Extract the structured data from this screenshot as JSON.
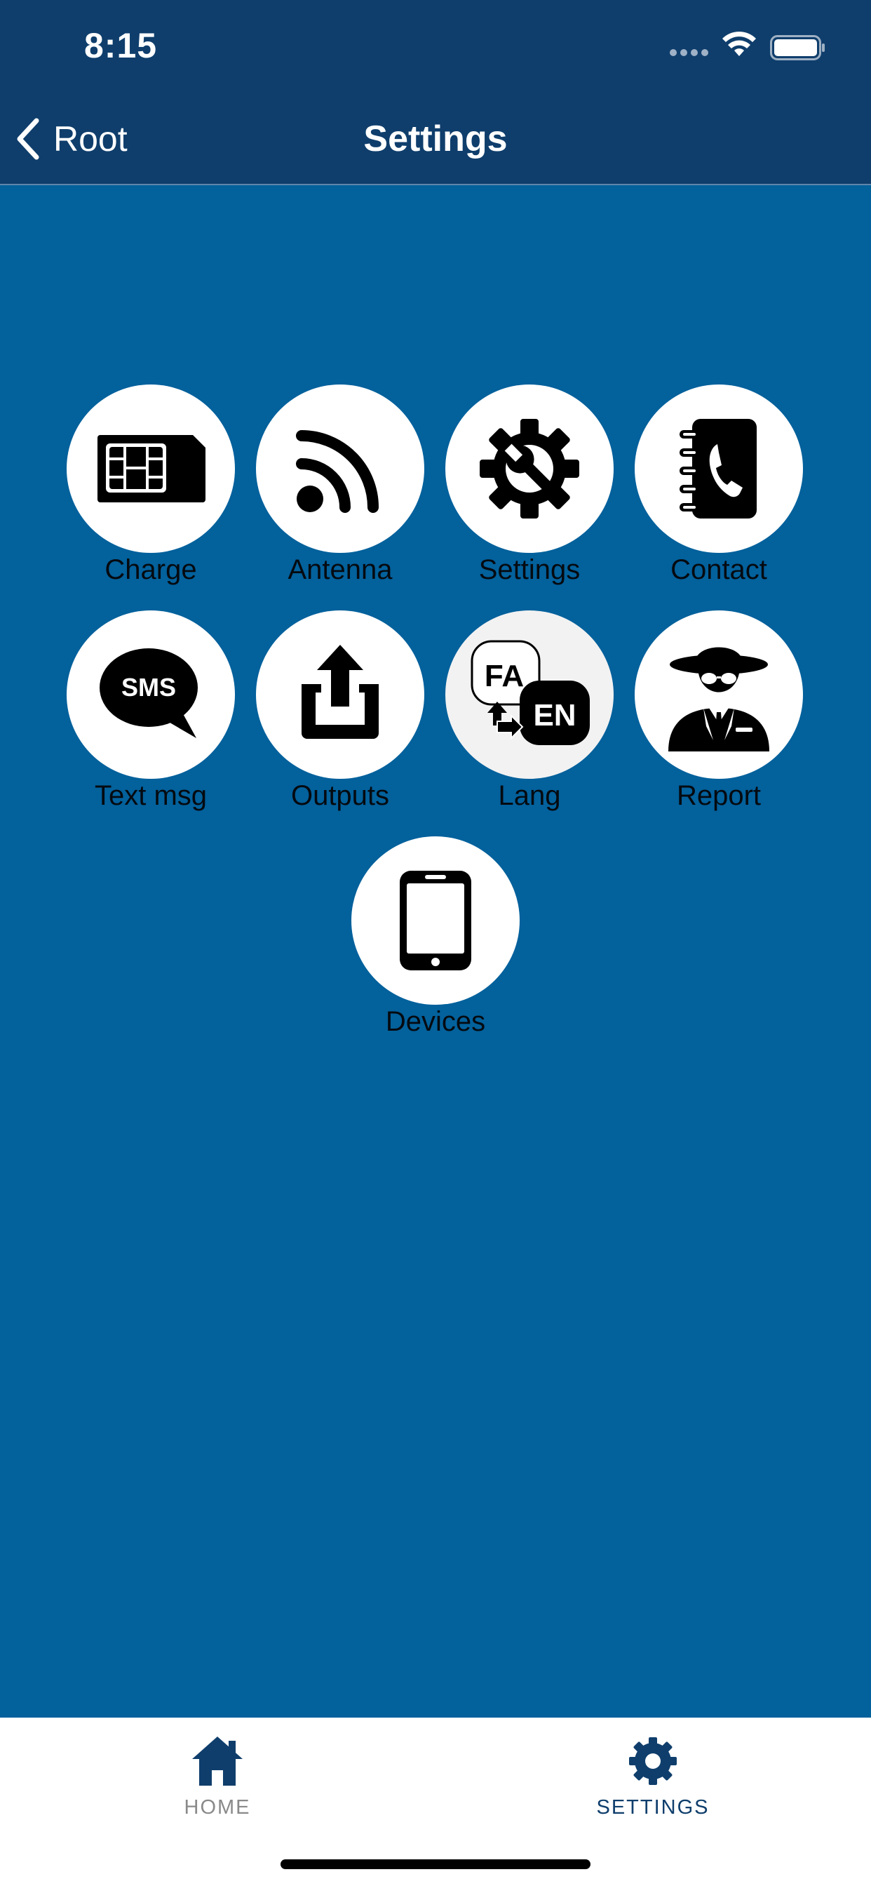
{
  "status_bar": {
    "time": "8:15"
  },
  "nav": {
    "back_label": "Root",
    "title": "Settings"
  },
  "tiles": [
    {
      "label": "Charge",
      "icon": "sim-card-icon"
    },
    {
      "label": "Antenna",
      "icon": "antenna-signal-icon"
    },
    {
      "label": "Settings",
      "icon": "gear-wrench-icon"
    },
    {
      "label": "Contact",
      "icon": "contact-book-icon"
    },
    {
      "label": "Text msg",
      "icon": "sms-bubble-icon",
      "icon_text": "SMS"
    },
    {
      "label": "Outputs",
      "icon": "export-icon"
    },
    {
      "label": "Lang",
      "icon": "language-switch-icon",
      "icon_text_1": "FA",
      "icon_text_2": "EN"
    },
    {
      "label": "Report",
      "icon": "agent-icon"
    },
    {
      "label": "Devices",
      "icon": "phone-device-icon"
    }
  ],
  "tabbar": {
    "items": [
      {
        "label": "HOME",
        "icon": "house-icon",
        "active": false
      },
      {
        "label": "SETTINGS",
        "icon": "gear-icon",
        "active": true
      }
    ]
  },
  "colors": {
    "header": "#0f3e6c",
    "background": "#03619c",
    "tile": "#ffffff",
    "active_tab": "#0f3e6c",
    "inactive_tab": "#8a8a8a"
  }
}
